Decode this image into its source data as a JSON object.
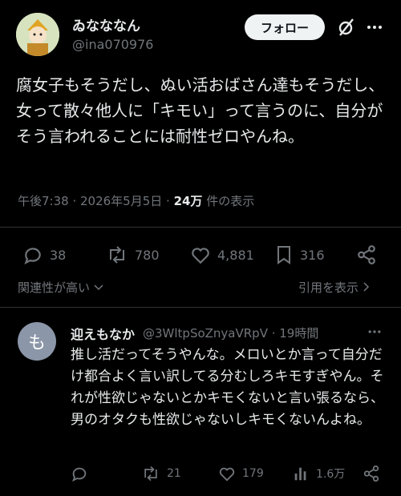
{
  "post": {
    "display_name": "ゐなななん",
    "handle": "@ina070976",
    "follow_label": "フォロー",
    "text": "腐女子もそうだし、ぬい活おばさん達もそうだし、女って散々他人に「キモい」って言うのに、自分がそう言われることには耐性ゼロやんね。",
    "time": "午後7:38 · 2026年5月5日 · ",
    "views": "24万",
    "views_suffix": " 件の表示",
    "replies": "38",
    "reposts": "780",
    "likes": "4,881",
    "bookmarks": "316",
    "relevance_label": "関連性が高い",
    "quote_label": "引用を表示"
  },
  "reply": {
    "avatar_letter": "も",
    "display_name": "迎えもなか",
    "handle": "@3WltpSoZnyaVRpV · 19時間",
    "text": "推し活だってそうやんな。メロいとか言って自分だけ都合よく言い訳してる分むしろキモすぎやん。それが性欲じゃないとかキモくないと言い張るなら、男のオタクも性欲じゃないしキモくないんよね。",
    "replies": "",
    "reposts": "21",
    "likes": "179",
    "views": "1.6万"
  },
  "colors": {
    "bg": "#000000",
    "text": "#e7e9ea",
    "muted": "#71767b",
    "divider": "#2f3336"
  }
}
